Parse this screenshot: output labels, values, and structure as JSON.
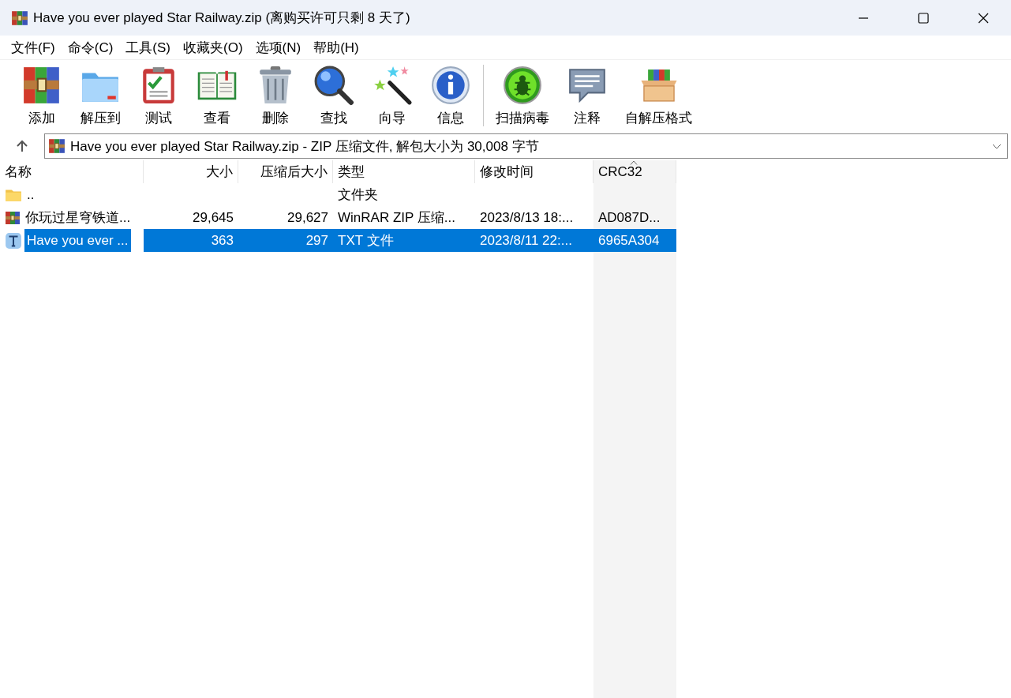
{
  "window": {
    "title": "Have you ever played Star Railway.zip (离购买许可只剩 8 天了)"
  },
  "menu": [
    "文件(F)",
    "命令(C)",
    "工具(S)",
    "收藏夹(O)",
    "选项(N)",
    "帮助(H)"
  ],
  "toolbar": {
    "groups": [
      [
        "添加",
        "解压到",
        "测试",
        "查看",
        "删除",
        "查找",
        "向导",
        "信息"
      ],
      [
        "扫描病毒",
        "注释",
        "自解压格式"
      ]
    ]
  },
  "address": {
    "value": "Have you ever played Star Railway.zip - ZIP 压缩文件, 解包大小为 30,008 字节"
  },
  "table": {
    "columns": [
      {
        "label": "名称",
        "sorted": false
      },
      {
        "label": "大小",
        "sorted": false
      },
      {
        "label": "压缩后大小",
        "sorted": false
      },
      {
        "label": "类型",
        "sorted": false
      },
      {
        "label": "修改时间",
        "sorted": false
      },
      {
        "label": "CRC32",
        "sorted": true
      }
    ],
    "rows": [
      {
        "kind": "folder",
        "selected": false,
        "cells": [
          "..",
          "",
          "",
          "文件夹",
          "",
          ""
        ]
      },
      {
        "kind": "archive",
        "selected": false,
        "cells": [
          "你玩过星穹铁道...",
          "29,645",
          "29,627",
          "WinRAR ZIP 压缩...",
          "2023/8/13 18:...",
          "AD087D..."
        ]
      },
      {
        "kind": "text",
        "selected": true,
        "cells": [
          "Have you ever ...",
          "363",
          "297",
          "TXT 文件",
          "2023/8/11 22:...",
          "6965A304"
        ]
      }
    ]
  }
}
